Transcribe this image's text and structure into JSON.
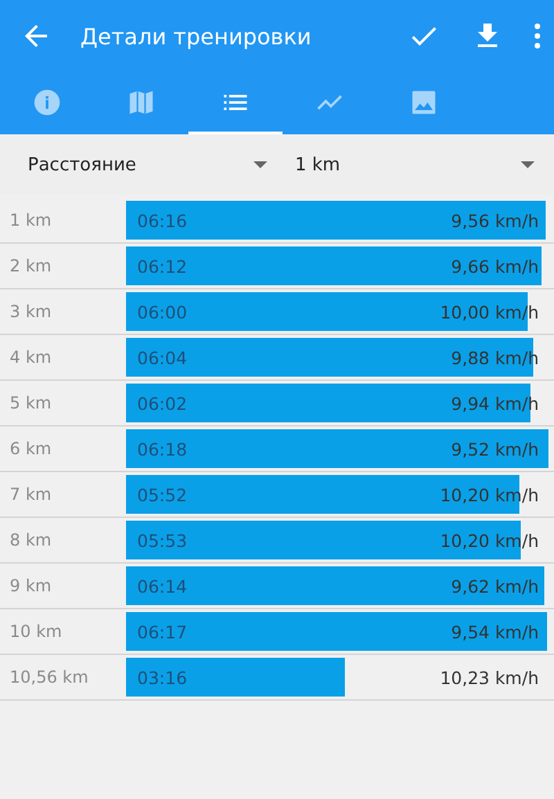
{
  "toolbar": {
    "title": "Детали тренировки"
  },
  "tabs": [
    {
      "kind": "info",
      "selected": false
    },
    {
      "kind": "map",
      "selected": false
    },
    {
      "kind": "list",
      "selected": true
    },
    {
      "kind": "chart",
      "selected": false
    },
    {
      "kind": "image",
      "selected": false
    }
  ],
  "filters": [
    {
      "value": "Расстояние"
    },
    {
      "value": "1 km"
    }
  ],
  "splits": [
    {
      "distance": "1 km",
      "time": "06:16",
      "speed": "9,56 km/h"
    },
    {
      "distance": "2 km",
      "time": "06:12",
      "speed": "9,66 km/h"
    },
    {
      "distance": "3 km",
      "time": "06:00",
      "speed": "10,00 km/h"
    },
    {
      "distance": "4 km",
      "time": "06:04",
      "speed": "9,88 km/h"
    },
    {
      "distance": "5 km",
      "time": "06:02",
      "speed": "9,94 km/h"
    },
    {
      "distance": "6 km",
      "time": "06:18",
      "speed": "9,52 km/h"
    },
    {
      "distance": "7 km",
      "time": "05:52",
      "speed": "10,20 km/h"
    },
    {
      "distance": "8 km",
      "time": "05:53",
      "speed": "10,20 km/h"
    },
    {
      "distance": "9 km",
      "time": "06:14",
      "speed": "9,62 km/h"
    },
    {
      "distance": "10 km",
      "time": "06:17",
      "speed": "9,54 km/h"
    },
    {
      "distance": "10,56 km",
      "time": "03:16",
      "speed": "10,23 km/h"
    }
  ]
}
